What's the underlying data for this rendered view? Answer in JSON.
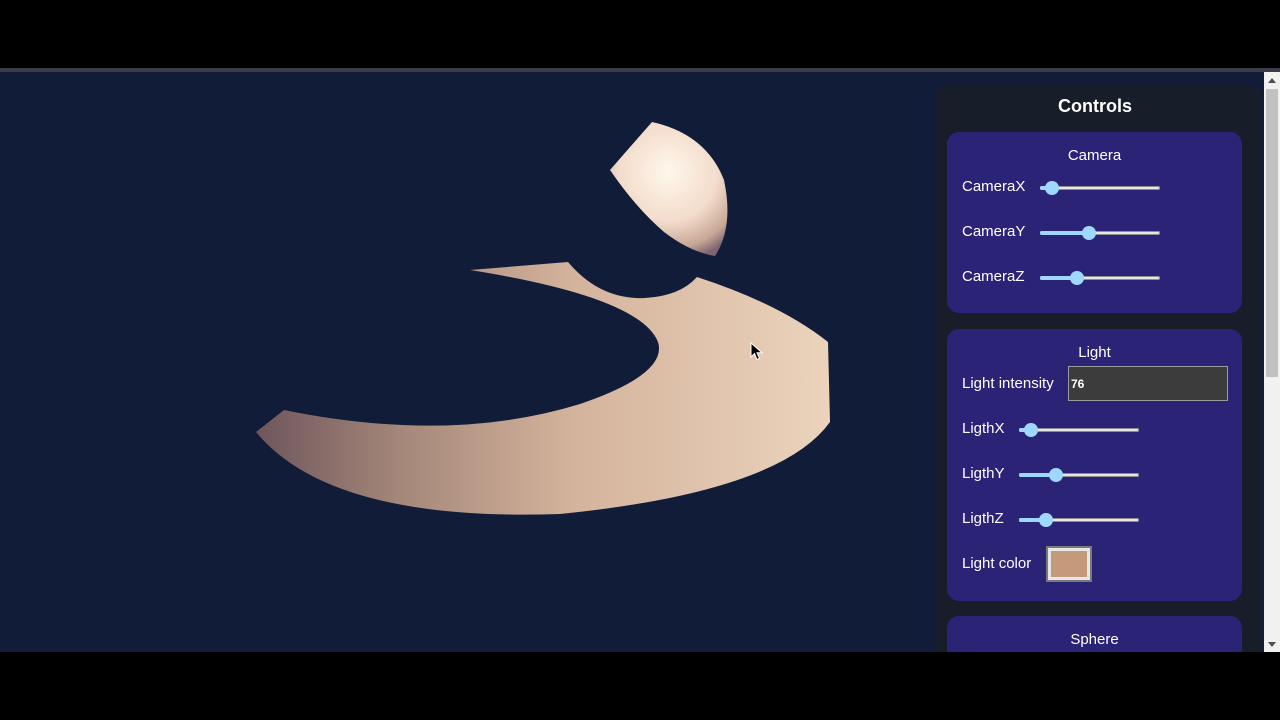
{
  "controls": {
    "title": "Controls",
    "camera": {
      "title": "Camera",
      "sliders": [
        {
          "label": "CameraX",
          "fraction": 0.05
        },
        {
          "label": "CameraY",
          "fraction": 0.4
        },
        {
          "label": "CameraZ",
          "fraction": 0.28
        }
      ]
    },
    "light": {
      "title": "Light",
      "intensity_label": "Light intensity",
      "intensity_value": "76",
      "sliders": [
        {
          "label": "LigthX",
          "fraction": 0.05
        },
        {
          "label": "LigthY",
          "fraction": 0.28
        },
        {
          "label": "LigthZ",
          "fraction": 0.19
        }
      ],
      "color_label": "Light color",
      "color": "#c49a7b"
    },
    "sphere": {
      "title": "Sphere"
    }
  },
  "colors": {
    "viewport_bg": "#111c38",
    "panel_bg": "#181d2a",
    "group_bg": "#2b2376",
    "slider_accent": "#9fd8ff"
  },
  "icons": {
    "scroll_up": "triangle-up-icon",
    "scroll_down": "triangle-down-icon",
    "cursor": "mouse-pointer-icon"
  }
}
